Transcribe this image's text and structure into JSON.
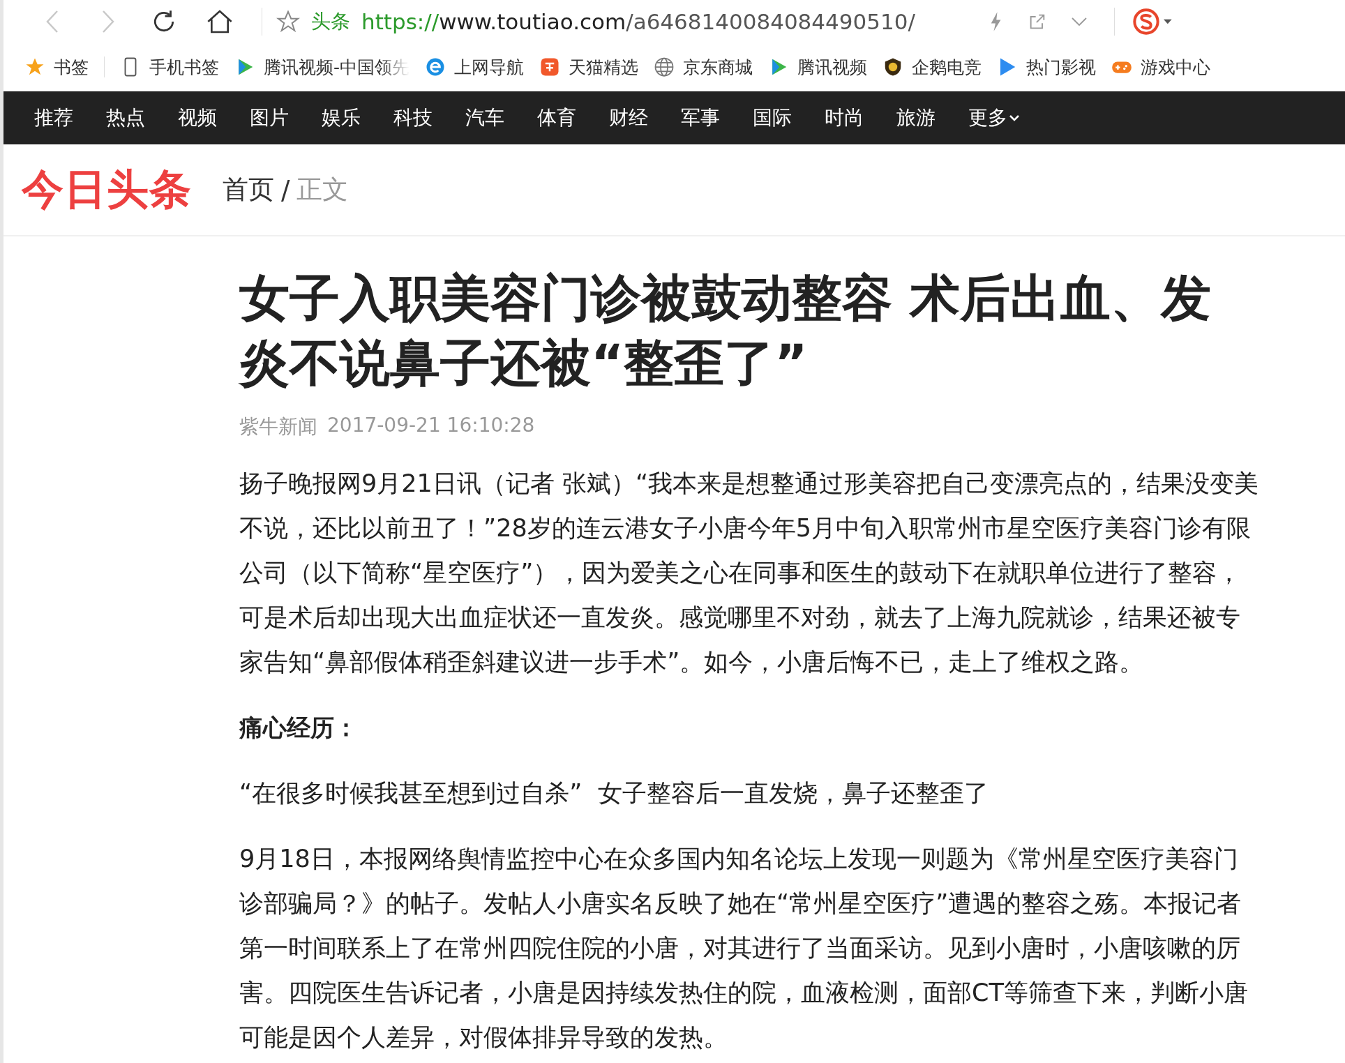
{
  "browser": {
    "back_disabled": true,
    "forward_disabled": true,
    "site_label": "头条",
    "url_scheme": "https://",
    "url_host": "www.toutiao.com",
    "url_path": "/a6468140084084490510/"
  },
  "bookmarks": [
    {
      "kind": "star",
      "label": "书签"
    },
    {
      "kind": "phone",
      "label": "手机书签"
    },
    {
      "kind": "video",
      "label": "腾讯视频-中国领先"
    },
    {
      "kind": "ie",
      "label": "上网导航"
    },
    {
      "kind": "tao",
      "label": "天猫精选"
    },
    {
      "kind": "globe",
      "label": "京东商城"
    },
    {
      "kind": "video",
      "label": "腾讯视频"
    },
    {
      "kind": "badge",
      "label": "企鹅电竞"
    },
    {
      "kind": "play",
      "label": "热门影视"
    },
    {
      "kind": "game",
      "label": "游戏中心"
    }
  ],
  "nav": {
    "items": [
      "推荐",
      "热点",
      "视频",
      "图片",
      "娱乐",
      "科技",
      "汽车",
      "体育",
      "财经",
      "军事",
      "国际",
      "时尚",
      "旅游"
    ],
    "more": "更多"
  },
  "header": {
    "logo": "今日头条",
    "breadcrumb": [
      "首页",
      "正文"
    ],
    "separator": "/"
  },
  "article": {
    "title": "女子入职美容门诊被鼓动整容 术后出血、发炎不说鼻子还被“整歪了”",
    "source": "紫牛新闻",
    "time": "2017-09-21 16:10:28",
    "blocks": [
      {
        "kind": "paragraph",
        "text": "扬子晚报网9月21日讯（记者 张斌）“我本来是想整通过形美容把自己变漂亮点的，结果没变美不说，还比以前丑了！”28岁的连云港女子小唐今年5月中旬入职常州市星空医疗美容门诊有限公司（以下简称“星空医疗”），因为爱美之心在同事和医生的鼓动下在就职单位进行了整容，可是术后却出现大出血症状还一直发炎。感觉哪里不对劲，就去了上海九院就诊，结果还被专家告知“鼻部假体稍歪斜建议进一步手术”。如今，小唐后悔不已，走上了维权之路。"
      },
      {
        "kind": "heading",
        "text": "痛心经历："
      },
      {
        "kind": "paragraph",
        "text": "“在很多时候我甚至想到过自杀”  女子整容后一直发烧，鼻子还整歪了"
      },
      {
        "kind": "paragraph",
        "text": "9月18日，本报网络舆情监控中心在众多国内知名论坛上发现一则题为《常州星空医疗美容门诊部骗局？》的帖子。发帖人小唐实名反映了她在“常州星空医疗”遭遇的整容之殇。本报记者第一时间联系上了在常州四院住院的小唐，对其进行了当面采访。见到小唐时，小唐咳嗽的厉害。四院医生告诉记者，小唐是因持续发热住的院，血液检测，面部CT等筛查下来，判断小唐可能是因个人差异，对假体排异导致的发热。"
      }
    ]
  }
}
